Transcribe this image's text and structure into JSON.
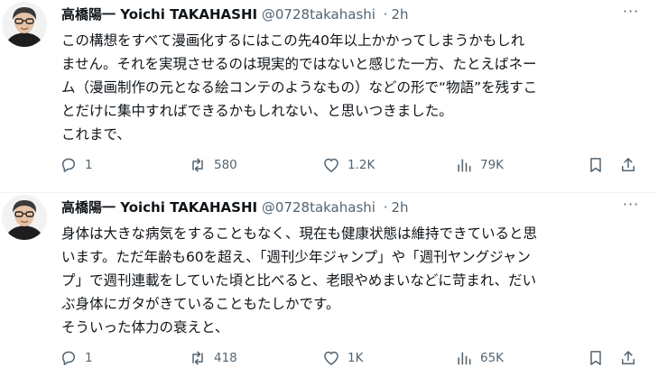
{
  "tweets": [
    {
      "author_name": "高橋陽一 Yoichi TAKAHASHI",
      "handle": "@0728takahashi",
      "separator": "·",
      "time": "2h",
      "more_label": "···",
      "lines": [
        "この構想をすべて漫画化するにはこの先40年以上かかってしまうかもしれ",
        "ません。それを実現させるのは現実的ではないと感じた一方、たとえばネー",
        "ム（漫画制作の元となる絵コンテのようなもの）などの形で“物語”を残すこ",
        "とだけに集中すればできるかもしれない、と思いつきました。",
        "これまで、"
      ],
      "replies": "1",
      "retweets": "580",
      "likes": "1.2K",
      "views": "79K"
    },
    {
      "author_name": "高橋陽一 Yoichi TAKAHASHI",
      "handle": "@0728takahashi",
      "separator": "·",
      "time": "2h",
      "more_label": "···",
      "lines": [
        "身体は大きな病気をすることもなく、現在も健康状態は維持できていると思",
        "います。ただ年齢も60を超え、「週刊少年ジャンプ」や「週刊ヤングジャン",
        "プ」で週刊連載をしていた頃と比べると、老眼やめまいなどに苛まれ、だい",
        "ぶ身体にガタがきていることもたしかです。",
        "そういった体力の衰えと、"
      ],
      "replies": "1",
      "retweets": "418",
      "likes": "1K",
      "views": "65K"
    }
  ],
  "icons": {
    "reply": "reply-icon",
    "retweet": "retweet-icon",
    "like": "heart-icon",
    "views": "views-icon",
    "bookmark": "bookmark-icon",
    "share": "share-icon"
  },
  "colors": {
    "text": "#0f1419",
    "secondary": "#536471",
    "divider": "#eff3f4"
  }
}
